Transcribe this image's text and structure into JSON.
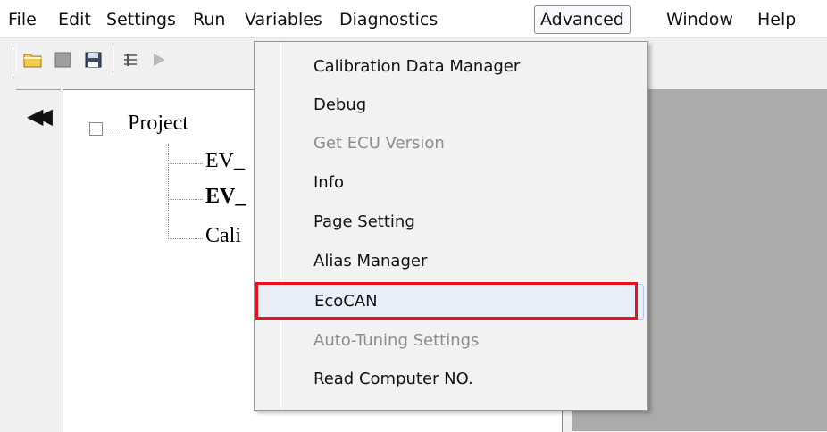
{
  "menubar": {
    "items": [
      "File",
      "Edit",
      "Settings",
      "Run",
      "Variables",
      "Diagnostics",
      "Advanced",
      "Window",
      "Help"
    ]
  },
  "tree": {
    "root": "Project",
    "children": [
      "EV_",
      "EV_",
      "Cali"
    ]
  },
  "dropdown": {
    "items": [
      "Calibration Data Manager",
      "Debug",
      "Get ECU Version",
      "Info",
      "Page Setting",
      "Alias Manager",
      "EcoCAN",
      "Auto-Tuning Settings",
      "Read Computer NO."
    ]
  },
  "colors": {
    "highlight": "#e3141f",
    "disabled_text": "#8d8d8d",
    "hover_bg": "#e8eff8"
  }
}
